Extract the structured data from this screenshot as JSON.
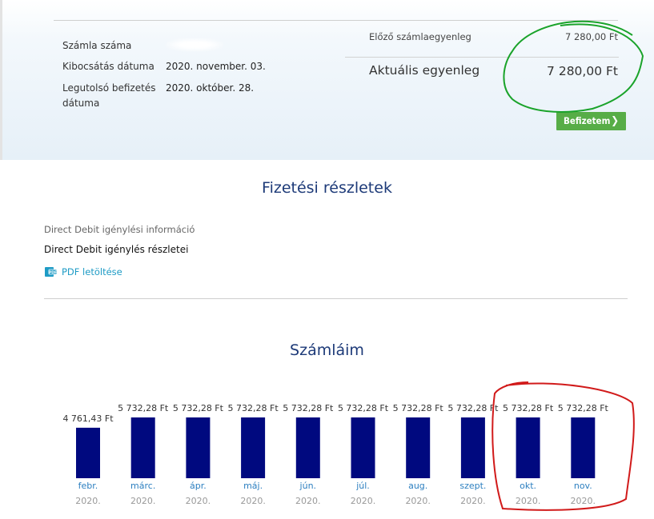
{
  "account": {
    "number_label": "Számla száma",
    "issue_date_label": "Kibocsátás dátuma",
    "issue_date_value": "2020. november. 03.",
    "last_payment_label": "Legutolsó befizetés",
    "last_payment_label_2": "dátuma",
    "last_payment_value": "2020. október. 28."
  },
  "balance": {
    "previous_label": "Előző számlaegyenleg",
    "previous_amount": "7 280,00 Ft",
    "current_label": "Aktuális egyenleg",
    "current_amount": "7 280,00 Ft",
    "pay_button": "Befizetem"
  },
  "payment_details": {
    "title": "Fizetési részletek",
    "dd_info": "Direct Debit igénylési információ",
    "dd_details": "Direct Debit igénylés részletei",
    "pdf_link": "PDF letöltése"
  },
  "invoices": {
    "title": "Számláim"
  },
  "colors": {
    "bar": "#00097f",
    "month_label": "#2c7fc0",
    "year_label": "#999999",
    "title": "#1d3a78",
    "pay_button": "#57ad47",
    "annotation_green": "#1aa32a",
    "annotation_red": "#d11a1a"
  },
  "icons": {
    "pay_chevron": "chevron-right-icon",
    "pdf": "pdf-icon"
  },
  "chart_data": {
    "type": "bar",
    "categories": [
      "febr.",
      "márc.",
      "ápr.",
      "máj.",
      "jún.",
      "júl.",
      "aug.",
      "szept.",
      "okt.",
      "nov."
    ],
    "years": [
      "2020.",
      "2020.",
      "2020.",
      "2020.",
      "2020.",
      "2020.",
      "2020.",
      "2020.",
      "2020.",
      "2020."
    ],
    "values": [
      4761.43,
      5732.28,
      5732.28,
      5732.28,
      5732.28,
      5732.28,
      5732.28,
      5732.28,
      5732.28,
      5732.28
    ],
    "value_labels": [
      "4 761,43 Ft",
      "5 732,28 Ft",
      "5 732,28 Ft",
      "5 732,28 Ft",
      "5 732,28 Ft",
      "5 732,28 Ft",
      "5 732,28 Ft",
      "5 732,28 Ft",
      "5 732,28 Ft",
      "5 732,28 Ft"
    ],
    "ylim": [
      0,
      5732.28
    ],
    "grid": false
  }
}
